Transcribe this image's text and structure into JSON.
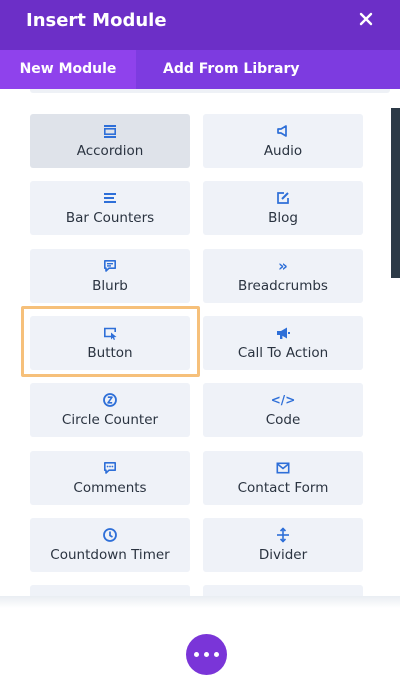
{
  "header": {
    "title": "Insert Module",
    "close_icon": "close-icon"
  },
  "tabs": [
    {
      "label": "New Module",
      "active": true
    },
    {
      "label": "Add From Library",
      "active": false
    }
  ],
  "modules": [
    {
      "label": "Accordion",
      "icon": "accordion-icon",
      "selected": true
    },
    {
      "label": "Audio",
      "icon": "audio-icon"
    },
    {
      "label": "Bar Counters",
      "icon": "bar-counters-icon"
    },
    {
      "label": "Blog",
      "icon": "blog-icon"
    },
    {
      "label": "Blurb",
      "icon": "blurb-icon"
    },
    {
      "label": "Breadcrumbs",
      "icon": "breadcrumbs-icon",
      "glyph": "»"
    },
    {
      "label": "Button",
      "icon": "button-icon",
      "highlighted": true
    },
    {
      "label": "Call To Action",
      "icon": "call-to-action-icon"
    },
    {
      "label": "Circle Counter",
      "icon": "circle-counter-icon"
    },
    {
      "label": "Code",
      "icon": "code-icon",
      "glyph": "</>"
    },
    {
      "label": "Comments",
      "icon": "comments-icon"
    },
    {
      "label": "Contact Form",
      "icon": "contact-form-icon"
    },
    {
      "label": "Countdown Timer",
      "icon": "countdown-timer-icon"
    },
    {
      "label": "Divider",
      "icon": "divider-icon"
    }
  ],
  "colors": {
    "header": "#6c2fc7",
    "tabs": "#7d3be0",
    "active_tab": "#8f42ec",
    "icon": "#2e6fd8",
    "highlight": "#f6c07a",
    "fab": "#7a35d8"
  },
  "fab": {
    "icon": "more-dots-icon"
  }
}
